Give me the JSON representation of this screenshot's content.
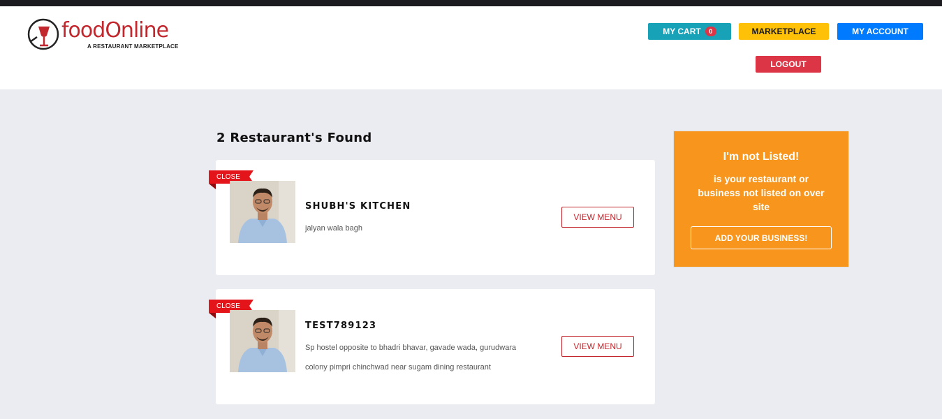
{
  "brand": {
    "name": "foodOnline",
    "tagline": "A RESTAURANT MARKETPLACE",
    "color": "#c1272d"
  },
  "nav": {
    "cart_label": "MY CART",
    "cart_count": "0",
    "marketplace_label": "MARKETPLACE",
    "account_label": "MY ACCOUNT",
    "logout_label": "LOGOUT"
  },
  "results": {
    "title": "2 Restaurant's Found",
    "restaurants": [
      {
        "status": "CLOSE",
        "name": "SHUBH'S KITCHEN",
        "address": "jalyan wala bagh",
        "action_label": "VIEW MENU"
      },
      {
        "status": "CLOSE",
        "name": "TEST789123",
        "address": "Sp hostel opposite to bhadri bhavar, gavade wada, gurudwara colony pimpri chinchwad near sugam dining restaurant",
        "action_label": "VIEW MENU"
      }
    ]
  },
  "promo": {
    "title": "I'm not Listed!",
    "text": "is your restaurant or business not listed on over site",
    "button_label": "ADD YOUR BUSINESS!",
    "background": "#f7951c"
  },
  "colors": {
    "cart": "#17a2b8",
    "marketplace": "#ffc107",
    "account": "#007bff",
    "logout": "#dc3545",
    "ribbon": "#e3151a"
  }
}
